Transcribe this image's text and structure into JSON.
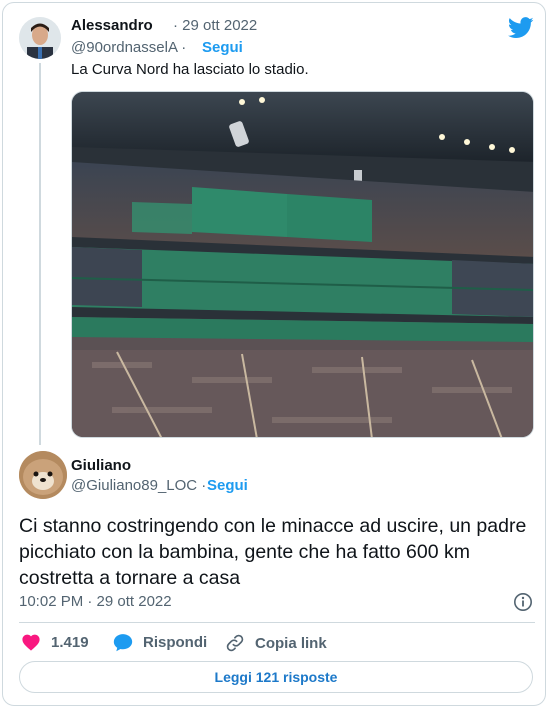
{
  "quoted_tweet": {
    "author_name": "Alessandro",
    "date": "· 29 ott 2022",
    "handle": "@90ordnasselA ·",
    "follow_label": "Segui",
    "text": "La Curva Nord ha lasciato lo stadio."
  },
  "main_tweet": {
    "author_name": "Giuliano",
    "handle": "@Giuliano89_LOC ·",
    "follow_label": "Segui",
    "text": "Ci stanno costringendo con le minacce ad uscire, un padre picchiato con la bambina, gente che ha fatto 600 km costretta a tornare a casa",
    "timestamp": "10:02 PM · 29 ott 2022"
  },
  "actions": {
    "like_count": "1.419",
    "reply_label": "Rispondi",
    "copy_link_label": "Copia link"
  },
  "read_replies_label": "Leggi 121 risposte",
  "icons": {
    "brand": "twitter-bird-icon",
    "like": "heart-icon",
    "reply": "speech-bubble-icon",
    "copy": "link-icon",
    "info": "info-icon"
  },
  "colors": {
    "accent": "#1d9bf0",
    "heart": "#f91880",
    "muted": "#536471",
    "border": "#cfd9de"
  }
}
